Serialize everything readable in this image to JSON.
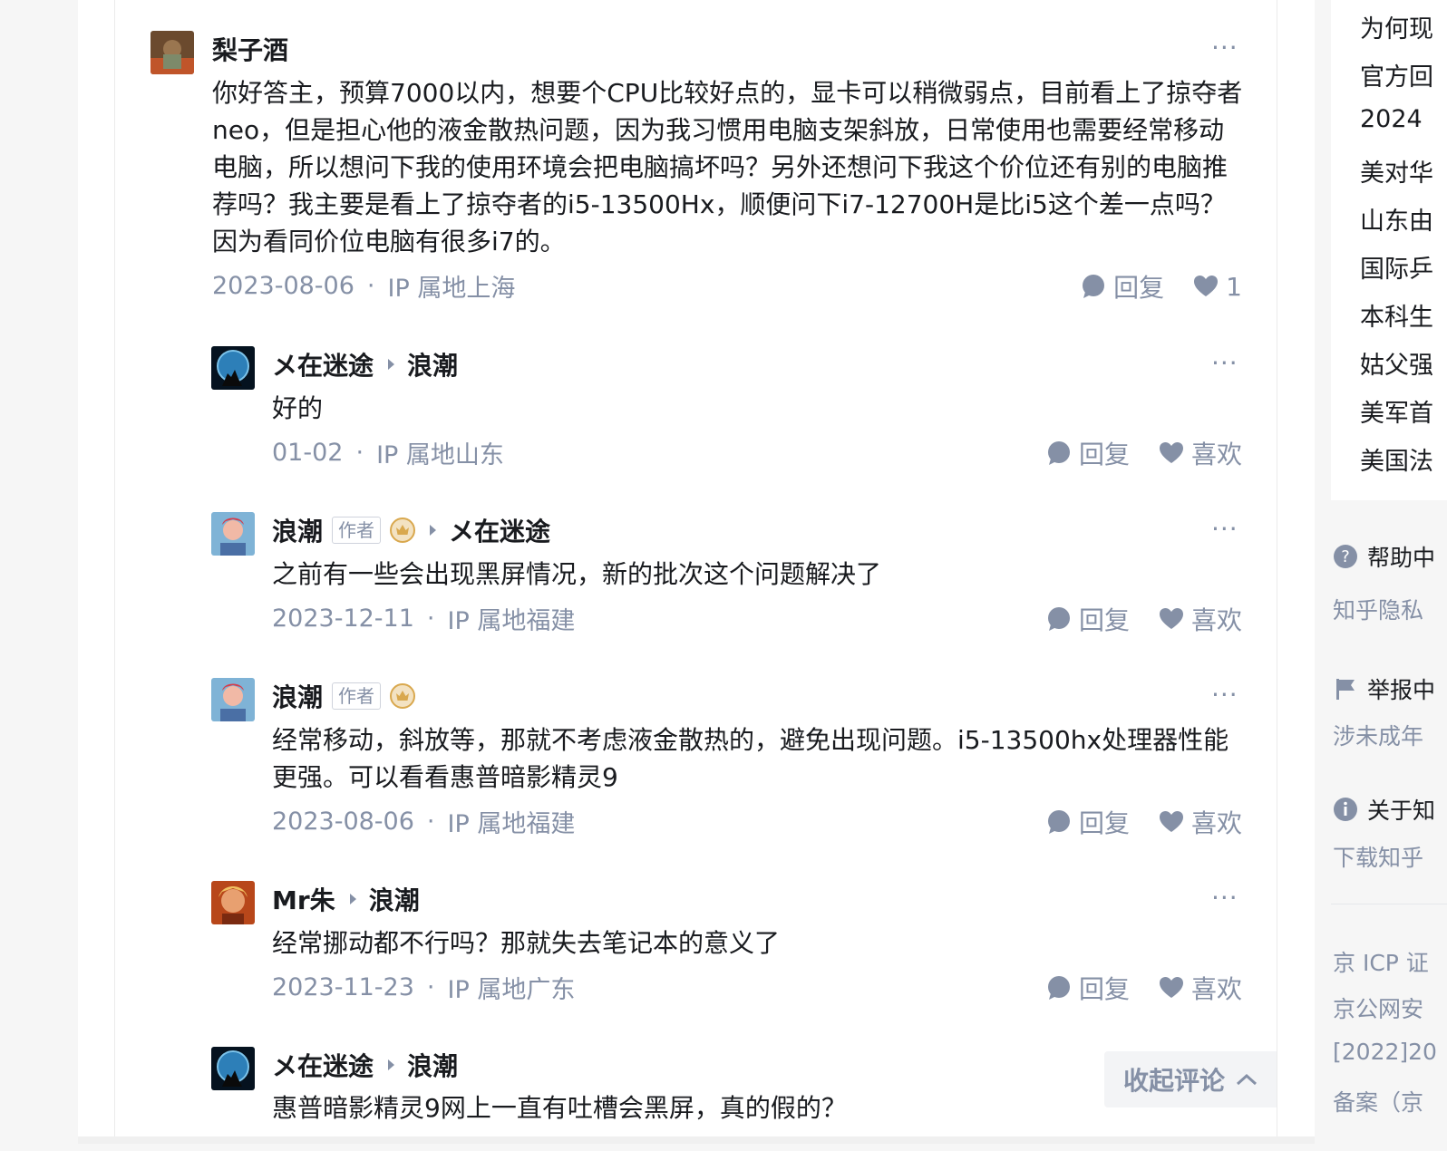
{
  "comments": [
    {
      "author": "梨子酒",
      "text": "你好答主，预算7000以内，想要个CPU比较好点的，显卡可以稍微弱点，目前看上了掠夺者neo，但是担心他的液金散热问题，因为我习惯用电脑支架斜放，日常使用也需要经常移动电脑，所以想问下我的使用环境会把电脑搞坏吗？另外还想问下我这个价位还有别的电脑推荐吗？我主要是看上了掠夺者的i5-13500Hx，顺便问下i7-12700H是比i5这个差一点吗？因为看同价位电脑有很多i7的。",
      "date": "2023-08-06",
      "location": "IP 属地上海",
      "reply_label": "回复",
      "like_label": "1"
    }
  ],
  "replies": [
    {
      "author": "メ在迷途",
      "reply_to": "浪潮",
      "text": "好的",
      "date": "01-02",
      "location": "IP 属地山东",
      "reply_label": "回复",
      "like_label": "喜欢"
    },
    {
      "author": "浪潮",
      "author_tag": "作者",
      "reply_to": "メ在迷途",
      "text": "之前有一些会出现黑屏情况，新的批次这个问题解决了",
      "date": "2023-12-11",
      "location": "IP 属地福建",
      "reply_label": "回复",
      "like_label": "喜欢"
    },
    {
      "author": "浪潮",
      "author_tag": "作者",
      "text": "经常移动，斜放等，那就不考虑液金散热的，避免出现问题。i5-13500hx处理器性能更强。可以看看惠普暗影精灵9",
      "date": "2023-08-06",
      "location": "IP 属地福建",
      "reply_label": "回复",
      "like_label": "喜欢"
    },
    {
      "author": "Mr朱",
      "reply_to": "浪潮",
      "text": "经常挪动都不行吗？那就失去笔记本的意义了",
      "date": "2023-11-23",
      "location": "IP 属地广东",
      "reply_label": "回复",
      "like_label": "喜欢"
    },
    {
      "author": "メ在迷途",
      "reply_to": "浪潮",
      "text": "惠普暗影精灵9网上一直有吐槽会黑屏，真的假的？"
    }
  ],
  "more_label": "···",
  "dot_sep": "·",
  "collapse_label": "收起评论",
  "sidebar": {
    "hot_list": [
      "为何现",
      "官方回",
      "2024",
      "美对华",
      "山东由",
      "国际乒",
      "本科生",
      "姑父强",
      "美军首",
      "美国法"
    ],
    "help_title": "帮助中",
    "help_link": "知乎隐私",
    "report_title": "举报中",
    "report_link": "涉未成年",
    "about_title": "关于知",
    "about_link": "下载知乎",
    "legal": [
      "京 ICP 证",
      "京公网安",
      "[2022]20",
      "备案（京"
    ]
  },
  "colors": {
    "muted": "#8590a6",
    "text": "#191b1f",
    "crown": "#d9a84e"
  }
}
